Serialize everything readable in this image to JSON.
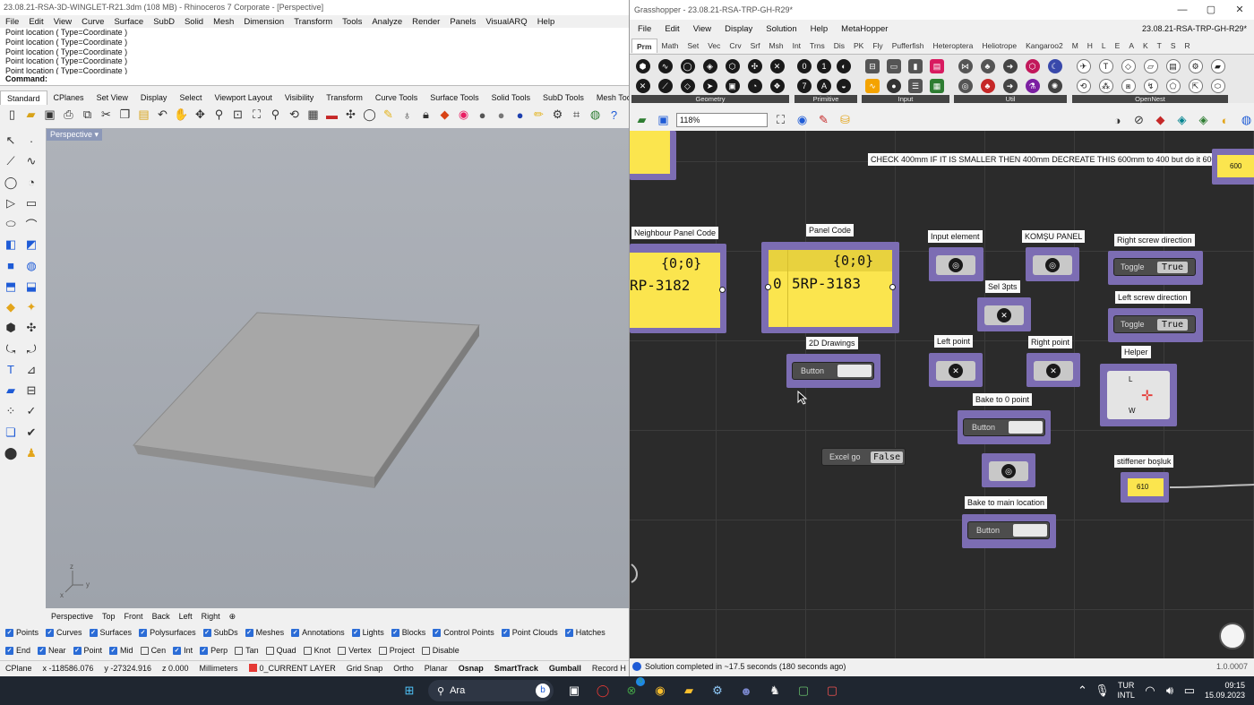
{
  "rhino": {
    "title": "23.08.21-RSA-3D-WINGLET-R21.3dm (108 MB) - Rhinoceros 7 Corporate - [Perspective]",
    "menu": [
      "File",
      "Edit",
      "View",
      "Curve",
      "Surface",
      "SubD",
      "Solid",
      "Mesh",
      "Dimension",
      "Transform",
      "Tools",
      "Analyze",
      "Render",
      "Panels",
      "VisualARQ",
      "Help"
    ],
    "history": [
      "Point location ( Type=Coordinate )",
      "Point location ( Type=Coordinate )",
      "Point location ( Type=Coordinate )",
      "Point location ( Type=Coordinate )",
      "Point location ( Type=Coordinate )"
    ],
    "command_label": "Command:",
    "toolbar_tabs": [
      "Standard",
      "CPlanes",
      "Set View",
      "Display",
      "Select",
      "Viewport Layout",
      "Visibility",
      "Transform",
      "Curve Tools",
      "Surface Tools",
      "Solid Tools",
      "SubD Tools",
      "Mesh Tools"
    ],
    "viewport_label": "Perspective",
    "viewport_tabs": [
      "Perspective",
      "Top",
      "Front",
      "Back",
      "Left",
      "Right"
    ],
    "filters": [
      {
        "label": "Points",
        "on": true
      },
      {
        "label": "Curves",
        "on": true
      },
      {
        "label": "Surfaces",
        "on": true
      },
      {
        "label": "Polysurfaces",
        "on": true
      },
      {
        "label": "SubDs",
        "on": true
      },
      {
        "label": "Meshes",
        "on": true
      },
      {
        "label": "Annotations",
        "on": true
      },
      {
        "label": "Lights",
        "on": true
      },
      {
        "label": "Blocks",
        "on": true
      },
      {
        "label": "Control Points",
        "on": true
      },
      {
        "label": "Point Clouds",
        "on": true
      },
      {
        "label": "Hatches",
        "on": true
      }
    ],
    "snaps": [
      {
        "label": "End",
        "on": true
      },
      {
        "label": "Near",
        "on": true
      },
      {
        "label": "Point",
        "on": true
      },
      {
        "label": "Mid",
        "on": true
      },
      {
        "label": "Cen",
        "on": false
      },
      {
        "label": "Int",
        "on": true
      },
      {
        "label": "Perp",
        "on": true
      },
      {
        "label": "Tan",
        "on": false
      },
      {
        "label": "Quad",
        "on": false
      },
      {
        "label": "Knot",
        "on": false
      },
      {
        "label": "Vertex",
        "on": false
      },
      {
        "label": "Project",
        "on": false
      },
      {
        "label": "Disable",
        "on": false
      }
    ],
    "status": {
      "cplane": "CPlane",
      "x": "x -118586.076",
      "y": "y -27324.916",
      "z": "z 0.000",
      "units": "Millimeters",
      "layer": "0_CURRENT LAYER",
      "layer_color": "#e53935",
      "toggles": [
        "Grid Snap",
        "Ortho",
        "Planar",
        "Osnap",
        "SmartTrack",
        "Gumball",
        "Record H"
      ]
    }
  },
  "gh": {
    "title": "Grasshopper - 23.08.21-RSA-TRP-GH-R29*",
    "file_label": "23.08.21-RSA-TRP-GH-R29*",
    "menu": [
      "File",
      "Edit",
      "View",
      "Display",
      "Solution",
      "Help",
      "MetaHopper"
    ],
    "tabs": [
      "Prm",
      "Math",
      "Set",
      "Vec",
      "Crv",
      "Srf",
      "Msh",
      "Int",
      "Trns",
      "Dis",
      "PK",
      "Fly",
      "Pufferfish",
      "Heteroptera",
      "Heliotrope",
      "Kangaroo2",
      "M",
      "H",
      "L",
      "E",
      "A",
      "K",
      "T",
      "S",
      "R"
    ],
    "groups": [
      "Geometry",
      "Primitive",
      "Input",
      "Util",
      "OpenNest"
    ],
    "zoom": "118%",
    "note": "CHECK 400mm IF IT IS SMALLER THEN 400mm DECREATE THIS 600mm to 400 but do it 600mm",
    "note_value": "600",
    "nodes": {
      "neighbour_label": "Neighbour Panel Code",
      "neighbour_path": "{0;0}",
      "neighbour_value": "RP-3182",
      "panel_label": "Panel Code",
      "panel_path": "{0;0}",
      "panel_index": "0",
      "panel_value": "5RP-3183",
      "input_element": "Input element",
      "komsu": "KOMŞU PANEL",
      "right_screw": "Right screw direction",
      "left_screw": "Left screw direction",
      "toggle_label": "Toggle",
      "toggle_value": "True",
      "sel3pts": "Sel 3pts",
      "drawings": "2D Drawings",
      "button": "Button",
      "left_point": "Left point",
      "right_point": "Right point",
      "helper": "Helper",
      "helper_l": "L",
      "helper_w": "W",
      "bake0": "Bake to 0 point",
      "bakemain": "Bake to main location",
      "excel": "Excel go",
      "excel_value": "False",
      "stiffener": "stiffener boşluk",
      "stiffener_value": "610"
    },
    "status": "Solution completed in ~17.5 seconds (180 seconds ago)",
    "version": "1.0.0007"
  },
  "taskbar": {
    "search": "Ara",
    "lang1": "TUR",
    "lang2": "INTL",
    "time": "09:15",
    "date": "15.09.2023",
    "badge": "5"
  }
}
